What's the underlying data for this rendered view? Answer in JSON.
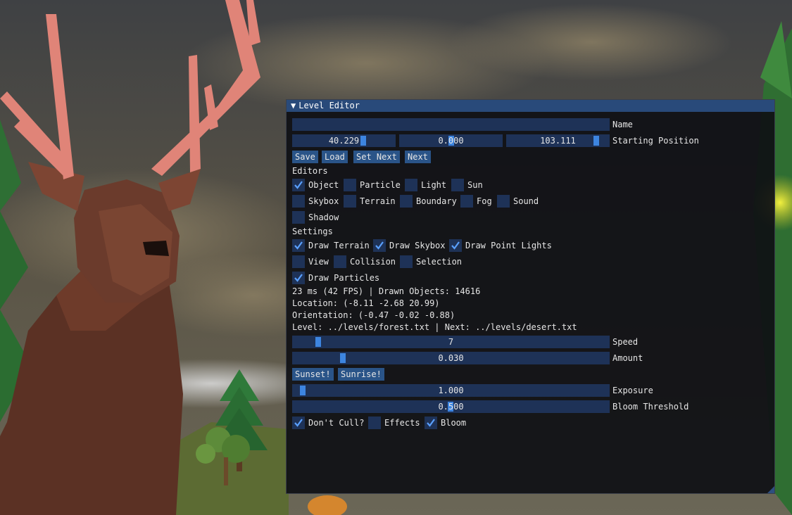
{
  "window": {
    "title": "Level Editor",
    "name_label": "Name",
    "name_value": "",
    "starting_position": {
      "label": "Starting Position",
      "x": "40.229",
      "y": "0.000",
      "z": "103.111"
    },
    "buttons": {
      "save": "Save",
      "load": "Load",
      "set_next": "Set Next",
      "next": "Next"
    },
    "editors": {
      "header": "Editors",
      "items": [
        {
          "label": "Object",
          "checked": true
        },
        {
          "label": "Particle",
          "checked": false
        },
        {
          "label": "Light",
          "checked": false
        },
        {
          "label": "Sun",
          "checked": false
        },
        {
          "label": "Skybox",
          "checked": false
        },
        {
          "label": "Terrain",
          "checked": false
        },
        {
          "label": "Boundary",
          "checked": false
        },
        {
          "label": "Fog",
          "checked": false
        },
        {
          "label": "Sound",
          "checked": false
        },
        {
          "label": "Shadow",
          "checked": false
        }
      ]
    },
    "settings": {
      "header": "Settings",
      "items": [
        {
          "label": "Draw Terrain",
          "checked": true
        },
        {
          "label": "Draw Skybox",
          "checked": true
        },
        {
          "label": "Draw Point Lights",
          "checked": true
        },
        {
          "label": "View",
          "checked": false
        },
        {
          "label": "Collision",
          "checked": false
        },
        {
          "label": "Selection",
          "checked": false
        },
        {
          "label": "Draw Particles",
          "checked": true
        }
      ]
    },
    "stats": {
      "perf": "23 ms (42 FPS) | Drawn Objects: 14616",
      "location": "Location: (-8.11 -2.68 20.99)",
      "orientation": "Orientation: (-0.47 -0.02 -0.88)",
      "level": "Level: ../levels/forest.txt | Next: ../levels/desert.txt"
    },
    "speed": {
      "label": "Speed",
      "value": "7"
    },
    "amount": {
      "label": "Amount",
      "value": "0.030"
    },
    "sun_buttons": {
      "sunset": "Sunset!",
      "sunrise": "Sunrise!"
    },
    "exposure": {
      "label": "Exposure",
      "value": "1.000"
    },
    "bloom_threshold": {
      "label": "Bloom Threshold",
      "value": "0.500"
    },
    "post": {
      "items": [
        {
          "label": "Don't Cull?",
          "checked": true
        },
        {
          "label": "Effects",
          "checked": false
        },
        {
          "label": "Bloom",
          "checked": true
        }
      ]
    }
  },
  "colors": {
    "title_bar": "#294a7a",
    "frame_bg": "#1e3257",
    "button_bg": "#2a5488",
    "accent": "#3d85e0",
    "sky": "#4a4c4c",
    "antler": "#e08478",
    "deer_body": "#6b3b2c"
  },
  "icons": [
    "collapse-triangle-icon",
    "checkmark-icon",
    "resize-grip-icon"
  ]
}
